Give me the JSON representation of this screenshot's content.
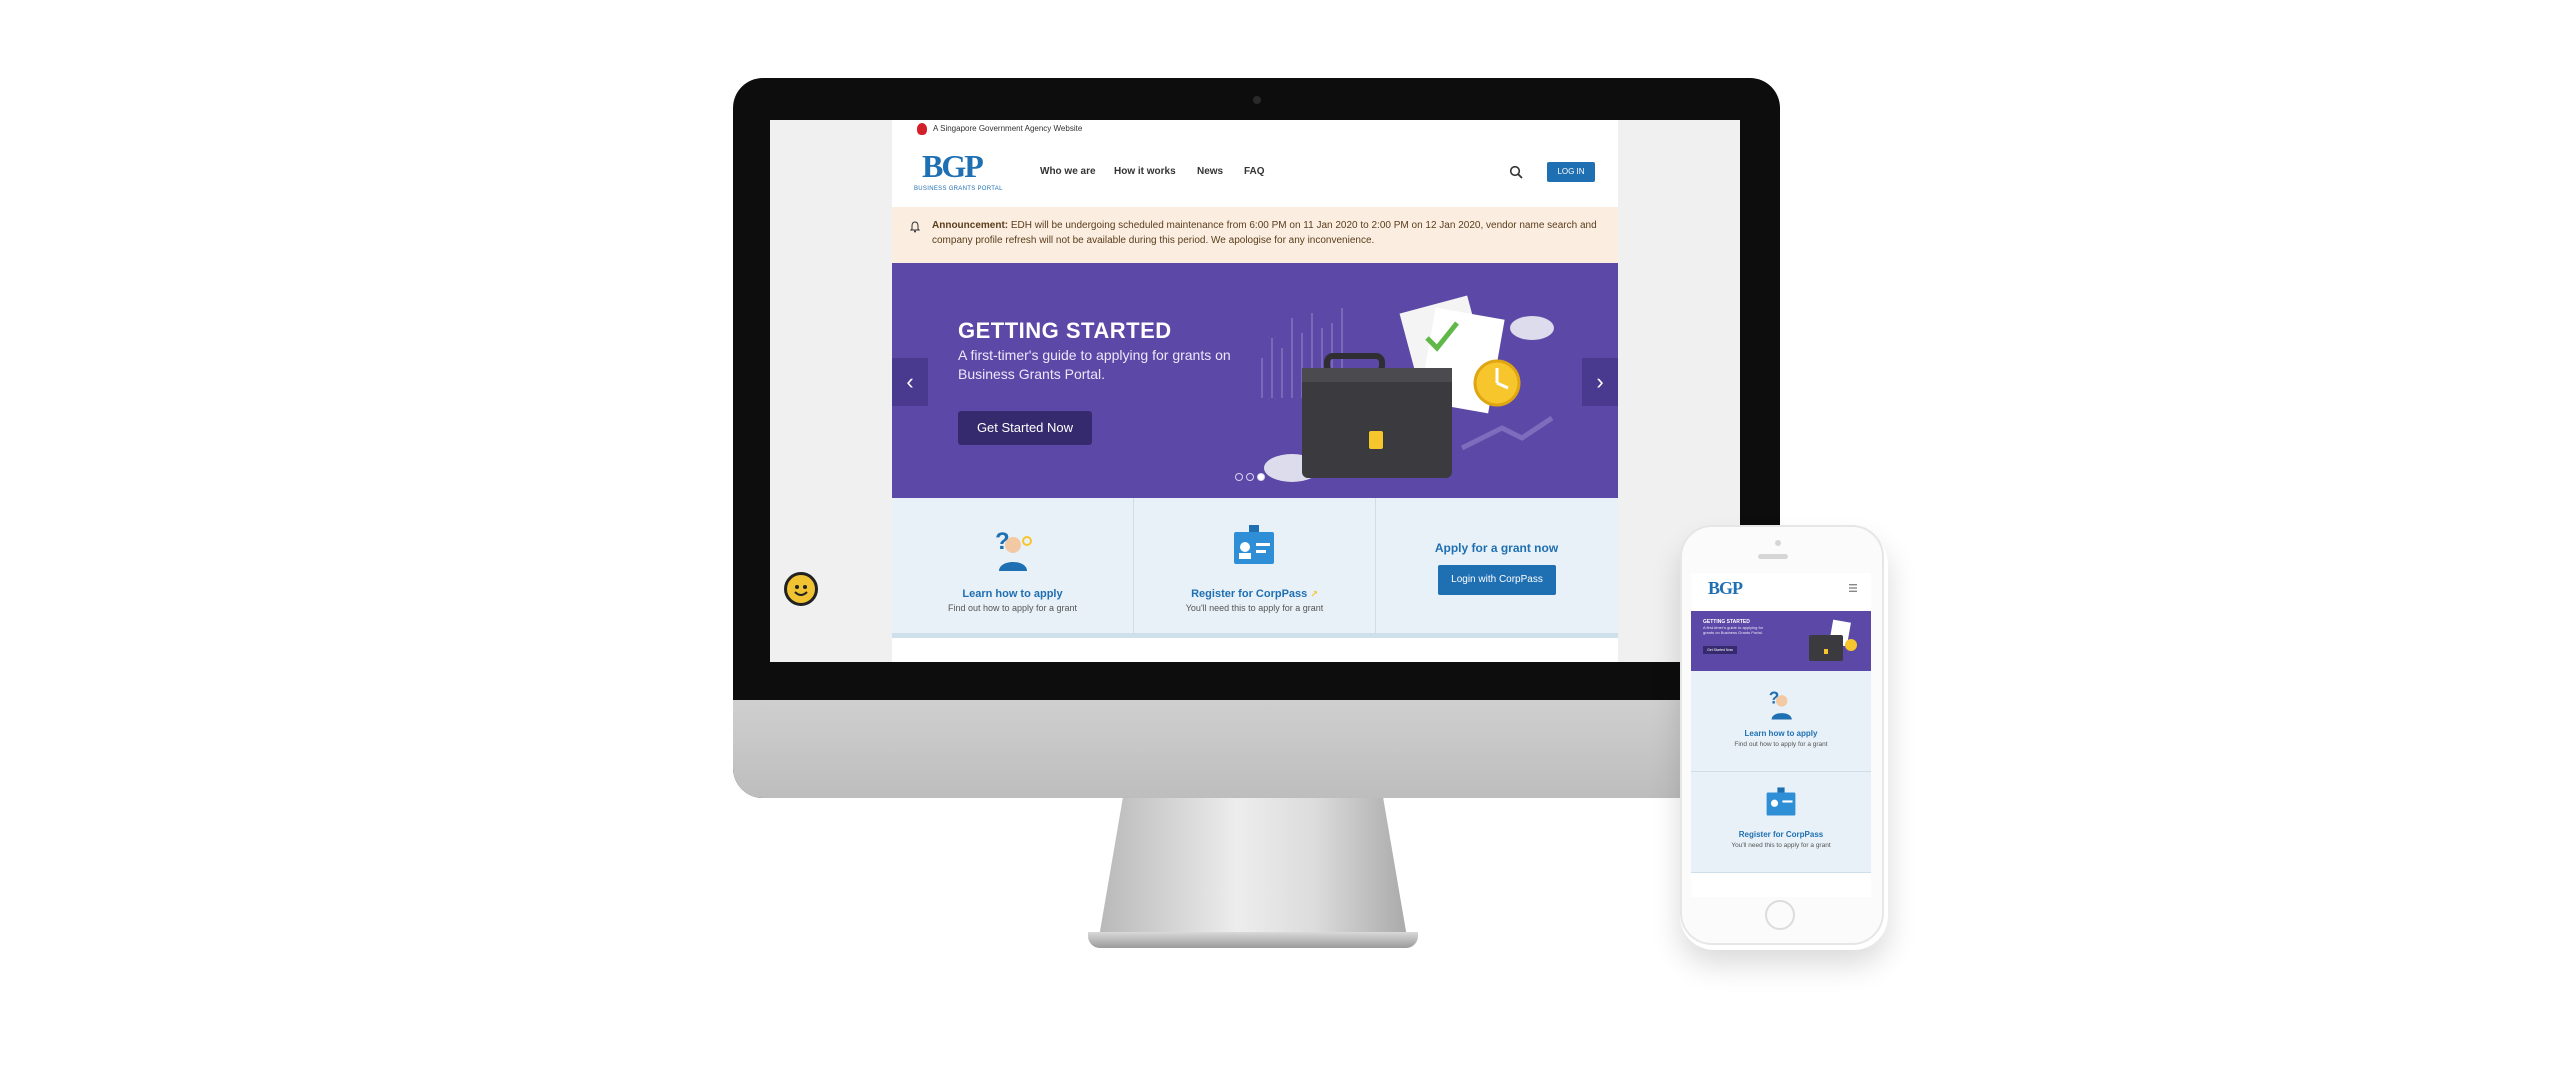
{
  "gov_bar": {
    "text": "A Singapore Government Agency Website"
  },
  "header": {
    "logo": "BGP",
    "logo_sub": "BUSINESS GRANTS PORTAL",
    "nav": [
      "Who we are",
      "How it works",
      "News",
      "FAQ"
    ],
    "login": "LOG IN"
  },
  "announcement": {
    "label": "Announcement:",
    "text": "EDH will be undergoing scheduled maintenance from 6:00 PM on 11 Jan 2020 to 2:00 PM on 12 Jan 2020, vendor name search and company profile refresh will not be available during this period. We apologise for any inconvenience."
  },
  "hero": {
    "title": "GETTING STARTED",
    "subtitle": "A first-timer's guide to applying for grants on Business Grants Portal.",
    "button": "Get Started Now",
    "prev": "‹",
    "next": "›"
  },
  "cards": {
    "learn_title": "Learn how to apply",
    "learn_sub": "Find out how to apply for a grant",
    "register_title": "Register for CorpPass",
    "register_sub": "You'll need this to apply for a grant",
    "apply_title": "Apply for a grant now",
    "apply_button": "Login with CorpPass"
  },
  "colors": {
    "brand_blue": "#1f6fb3",
    "hero_purple": "#5c48a6",
    "announce_bg": "#fbeee0",
    "card_bg": "#e8f1f7"
  }
}
